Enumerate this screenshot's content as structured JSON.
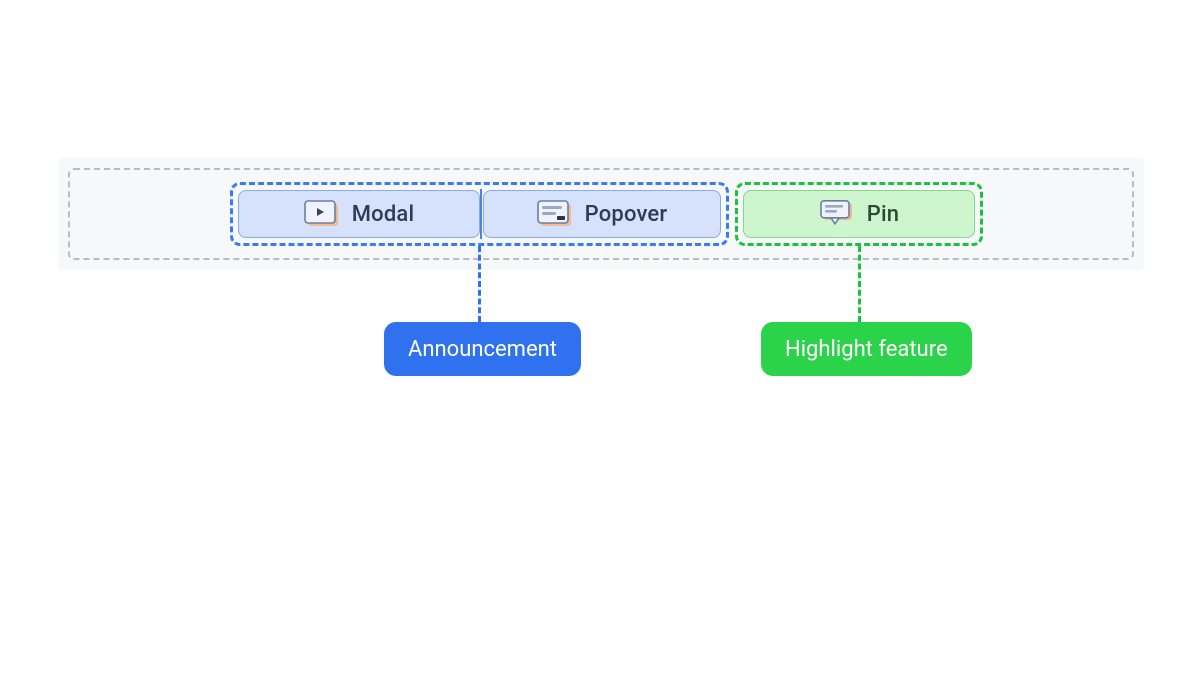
{
  "groups": {
    "announcement": {
      "callout_label": "Announcement",
      "cards": [
        {
          "id": "modal",
          "label": "Modal",
          "icon": "modal-icon"
        },
        {
          "id": "popover",
          "label": "Popover",
          "icon": "popover-icon"
        }
      ]
    },
    "highlight": {
      "callout_label": "Highlight feature",
      "cards": [
        {
          "id": "pin",
          "label": "Pin",
          "icon": "pin-icon"
        }
      ]
    }
  },
  "colors": {
    "announcement": "#2f71ef",
    "highlight": "#2ad34a"
  }
}
